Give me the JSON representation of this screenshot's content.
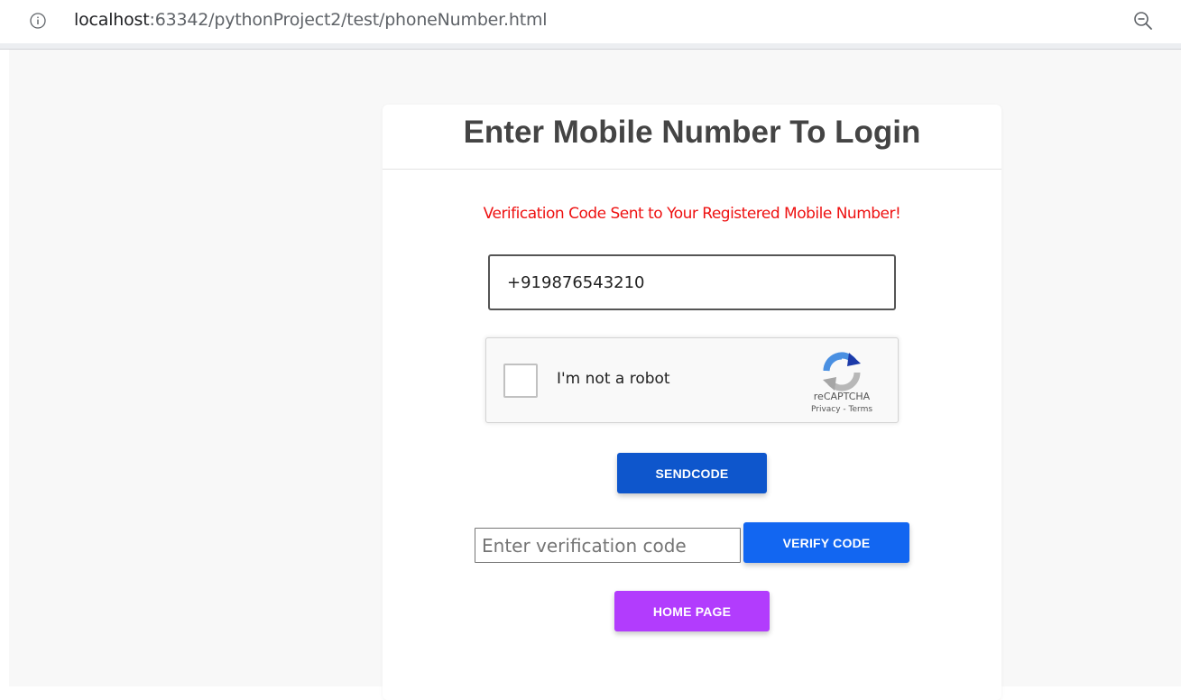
{
  "browser": {
    "url_host": "localhost",
    "url_rest": ":63342/pythonProject2/test/phoneNumber.html",
    "icons": {
      "info": "info-icon",
      "zoom": "zoom-out-icon"
    }
  },
  "card": {
    "title": "Enter Mobile Number To Login",
    "status_message": "Verification Code Sent to Your Registered Mobile Number!",
    "status_color": "#ee1111"
  },
  "phone_input": {
    "value": "+919876543210"
  },
  "recaptcha": {
    "label": "I'm not a robot",
    "brand": "reCAPTCHA",
    "links": "Privacy - Terms",
    "checked": false
  },
  "buttons": {
    "send_code": "SENDCODE",
    "verify_code": "VERIFY CODE",
    "home_page": "HOME PAGE"
  },
  "code_input": {
    "value": "",
    "placeholder": "Enter verification code"
  },
  "colors": {
    "send_button": "#0e56cc",
    "verify_button": "#1266f1",
    "home_button": "#b23cfd"
  }
}
